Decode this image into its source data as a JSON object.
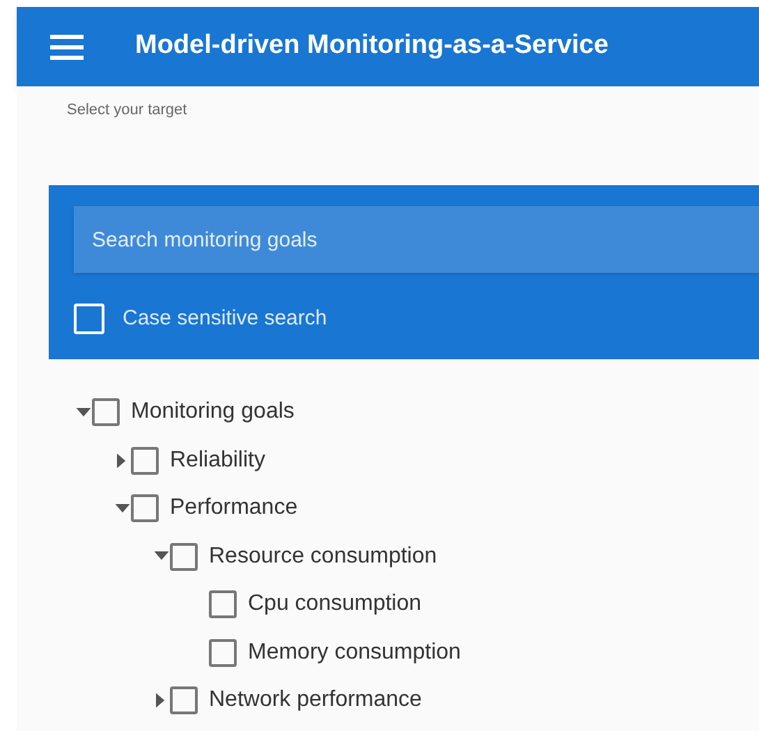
{
  "app_bar": {
    "title": "Model-driven Monitoring-as-a-Service"
  },
  "subtitle": "Select your target",
  "search": {
    "placeholder": "Search monitoring goals"
  },
  "case_sensitive": {
    "label": "Case sensitive search",
    "checked": false
  },
  "tree": [
    {
      "label": "Monitoring goals",
      "checked": false,
      "expanded": true,
      "children": [
        {
          "label": "Reliability",
          "checked": false,
          "expanded": false
        },
        {
          "label": "Performance",
          "checked": false,
          "expanded": true,
          "children": [
            {
              "label": "Resource consumption",
              "checked": false,
              "expanded": true,
              "children": [
                {
                  "label": "Cpu consumption",
                  "checked": false
                },
                {
                  "label": "Memory consumption",
                  "checked": false
                }
              ]
            },
            {
              "label": "Network performance",
              "checked": false,
              "expanded": false
            }
          ]
        }
      ]
    }
  ]
}
